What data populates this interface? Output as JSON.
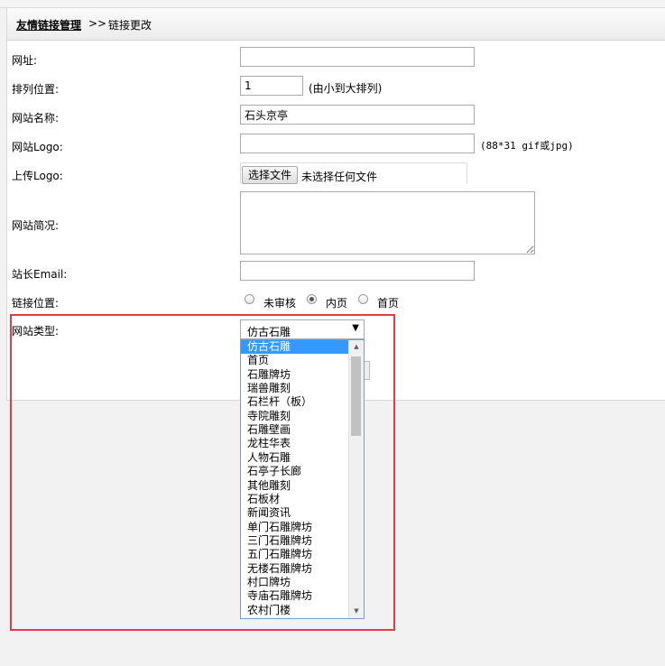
{
  "breadcrumb": {
    "link": "友情链接管理",
    "separator": ">>",
    "current": "链接更改"
  },
  "form": {
    "url_label": "网址:",
    "url_value": "",
    "order_label": "排列位置:",
    "order_value": "1",
    "order_hint": "(由小到大排列)",
    "name_label": "网站名称:",
    "name_value": "石头京亭",
    "logo_label": "网站Logo:",
    "logo_value": "",
    "logo_hint": "(88*31 gif或jpg)",
    "upload_label": "上传Logo:",
    "upload_button": "选择文件",
    "upload_status": "未选择任何文件",
    "desc_label": "网站简况:",
    "email_label": "站长Email:",
    "email_value": "",
    "position_label": "链接位置:",
    "position_options": [
      "未审核",
      "内页",
      "首页"
    ],
    "position_selected": "内页",
    "type_label": "网站类型:",
    "type_selected": "仿古石雕",
    "type_options": [
      "仿古石雕",
      "首页",
      "石雕牌坊",
      "瑞兽雕刻",
      "石栏杆（板）",
      "寺院雕刻",
      "石雕壁画",
      "龙柱华表",
      "人物石雕",
      "石亭子长廊",
      "其他雕刻",
      "石板材",
      "新闻资讯",
      "单门石雕牌坊",
      "三门石雕牌坊",
      "五门石雕牌坊",
      "无楼石雕牌坊",
      "村口牌坊",
      "寺庙石雕牌坊",
      "农村门楼"
    ]
  },
  "icons": {
    "dropdown_arrow": "triangle-down-icon",
    "scroll_up": "triangle-up-icon",
    "scroll_down": "triangle-down-icon"
  },
  "colors": {
    "highlight": "#3399ff",
    "annotation_border": "#e23c43"
  }
}
